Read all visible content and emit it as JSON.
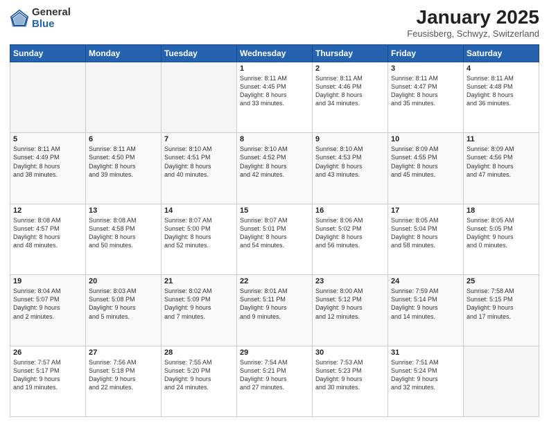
{
  "logo": {
    "general": "General",
    "blue": "Blue"
  },
  "header": {
    "month": "January 2025",
    "location": "Feusisberg, Schwyz, Switzerland"
  },
  "days_of_week": [
    "Sunday",
    "Monday",
    "Tuesday",
    "Wednesday",
    "Thursday",
    "Friday",
    "Saturday"
  ],
  "weeks": [
    [
      {
        "day": "",
        "info": ""
      },
      {
        "day": "",
        "info": ""
      },
      {
        "day": "",
        "info": ""
      },
      {
        "day": "1",
        "info": "Sunrise: 8:11 AM\nSunset: 4:45 PM\nDaylight: 8 hours\nand 33 minutes."
      },
      {
        "day": "2",
        "info": "Sunrise: 8:11 AM\nSunset: 4:46 PM\nDaylight: 8 hours\nand 34 minutes."
      },
      {
        "day": "3",
        "info": "Sunrise: 8:11 AM\nSunset: 4:47 PM\nDaylight: 8 hours\nand 35 minutes."
      },
      {
        "day": "4",
        "info": "Sunrise: 8:11 AM\nSunset: 4:48 PM\nDaylight: 8 hours\nand 36 minutes."
      }
    ],
    [
      {
        "day": "5",
        "info": "Sunrise: 8:11 AM\nSunset: 4:49 PM\nDaylight: 8 hours\nand 38 minutes."
      },
      {
        "day": "6",
        "info": "Sunrise: 8:11 AM\nSunset: 4:50 PM\nDaylight: 8 hours\nand 39 minutes."
      },
      {
        "day": "7",
        "info": "Sunrise: 8:10 AM\nSunset: 4:51 PM\nDaylight: 8 hours\nand 40 minutes."
      },
      {
        "day": "8",
        "info": "Sunrise: 8:10 AM\nSunset: 4:52 PM\nDaylight: 8 hours\nand 42 minutes."
      },
      {
        "day": "9",
        "info": "Sunrise: 8:10 AM\nSunset: 4:53 PM\nDaylight: 8 hours\nand 43 minutes."
      },
      {
        "day": "10",
        "info": "Sunrise: 8:09 AM\nSunset: 4:55 PM\nDaylight: 8 hours\nand 45 minutes."
      },
      {
        "day": "11",
        "info": "Sunrise: 8:09 AM\nSunset: 4:56 PM\nDaylight: 8 hours\nand 47 minutes."
      }
    ],
    [
      {
        "day": "12",
        "info": "Sunrise: 8:08 AM\nSunset: 4:57 PM\nDaylight: 8 hours\nand 48 minutes."
      },
      {
        "day": "13",
        "info": "Sunrise: 8:08 AM\nSunset: 4:58 PM\nDaylight: 8 hours\nand 50 minutes."
      },
      {
        "day": "14",
        "info": "Sunrise: 8:07 AM\nSunset: 5:00 PM\nDaylight: 8 hours\nand 52 minutes."
      },
      {
        "day": "15",
        "info": "Sunrise: 8:07 AM\nSunset: 5:01 PM\nDaylight: 8 hours\nand 54 minutes."
      },
      {
        "day": "16",
        "info": "Sunrise: 8:06 AM\nSunset: 5:02 PM\nDaylight: 8 hours\nand 56 minutes."
      },
      {
        "day": "17",
        "info": "Sunrise: 8:05 AM\nSunset: 5:04 PM\nDaylight: 8 hours\nand 58 minutes."
      },
      {
        "day": "18",
        "info": "Sunrise: 8:05 AM\nSunset: 5:05 PM\nDaylight: 9 hours\nand 0 minutes."
      }
    ],
    [
      {
        "day": "19",
        "info": "Sunrise: 8:04 AM\nSunset: 5:07 PM\nDaylight: 9 hours\nand 2 minutes."
      },
      {
        "day": "20",
        "info": "Sunrise: 8:03 AM\nSunset: 5:08 PM\nDaylight: 9 hours\nand 5 minutes."
      },
      {
        "day": "21",
        "info": "Sunrise: 8:02 AM\nSunset: 5:09 PM\nDaylight: 9 hours\nand 7 minutes."
      },
      {
        "day": "22",
        "info": "Sunrise: 8:01 AM\nSunset: 5:11 PM\nDaylight: 9 hours\nand 9 minutes."
      },
      {
        "day": "23",
        "info": "Sunrise: 8:00 AM\nSunset: 5:12 PM\nDaylight: 9 hours\nand 12 minutes."
      },
      {
        "day": "24",
        "info": "Sunrise: 7:59 AM\nSunset: 5:14 PM\nDaylight: 9 hours\nand 14 minutes."
      },
      {
        "day": "25",
        "info": "Sunrise: 7:58 AM\nSunset: 5:15 PM\nDaylight: 9 hours\nand 17 minutes."
      }
    ],
    [
      {
        "day": "26",
        "info": "Sunrise: 7:57 AM\nSunset: 5:17 PM\nDaylight: 9 hours\nand 19 minutes."
      },
      {
        "day": "27",
        "info": "Sunrise: 7:56 AM\nSunset: 5:18 PM\nDaylight: 9 hours\nand 22 minutes."
      },
      {
        "day": "28",
        "info": "Sunrise: 7:55 AM\nSunset: 5:20 PM\nDaylight: 9 hours\nand 24 minutes."
      },
      {
        "day": "29",
        "info": "Sunrise: 7:54 AM\nSunset: 5:21 PM\nDaylight: 9 hours\nand 27 minutes."
      },
      {
        "day": "30",
        "info": "Sunrise: 7:53 AM\nSunset: 5:23 PM\nDaylight: 9 hours\nand 30 minutes."
      },
      {
        "day": "31",
        "info": "Sunrise: 7:51 AM\nSunset: 5:24 PM\nDaylight: 9 hours\nand 32 minutes."
      },
      {
        "day": "",
        "info": ""
      }
    ]
  ]
}
